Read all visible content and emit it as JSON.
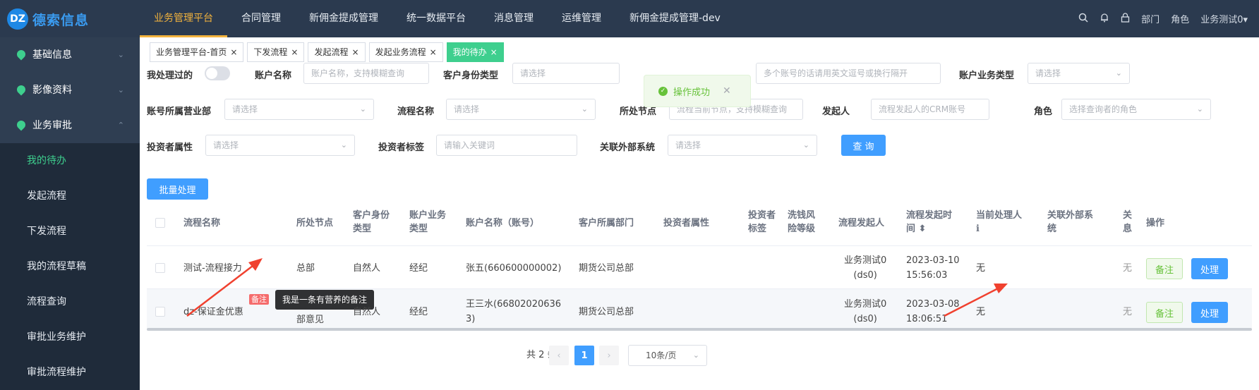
{
  "app": {
    "logo_mark": "DZ",
    "name": "德索信息"
  },
  "topnav": {
    "items": [
      "业务管理平台",
      "合同管理",
      "新佣金提成管理",
      "统一数据平台",
      "消息管理",
      "运维管理",
      "新佣金提成管理-dev"
    ],
    "right": {
      "dept": "部门",
      "role": "角色",
      "user": "业务测试0▾"
    }
  },
  "sidebar": {
    "groups": [
      {
        "label": "基础信息",
        "chevron": "⌄"
      },
      {
        "label": "影像资料",
        "chevron": "⌄"
      },
      {
        "label": "业务审批",
        "chevron": "⌃"
      }
    ],
    "subitems": [
      "我的待办",
      "发起流程",
      "下发流程",
      "我的流程草稿",
      "流程查询",
      "审批业务维护",
      "审批流程维护"
    ]
  },
  "tabs": [
    {
      "label": "业务管理平台-首页"
    },
    {
      "label": "下发流程"
    },
    {
      "label": "发起流程"
    },
    {
      "label": "发起业务流程"
    },
    {
      "label": "我的待办"
    }
  ],
  "toast": {
    "text": "操作成功"
  },
  "filters": {
    "my_processed": "我处理过的",
    "account_name": {
      "label": "账户名称",
      "placeholder": "账户名称，支持模糊查询"
    },
    "customer_type": {
      "label": "客户身份类型",
      "placeholder": "请选择"
    },
    "account_numbers": {
      "placeholder": "多个账号的话请用英文逗号或换行隔开"
    },
    "account_biz_type": {
      "label": "账户业务类型",
      "placeholder": "请选择"
    },
    "account_dept": {
      "label": "账号所属营业部",
      "placeholder": "请选择"
    },
    "process_name": {
      "label": "流程名称",
      "placeholder": "请选择"
    },
    "node": {
      "label": "所处节点",
      "placeholder": "流程当前节点，支持模糊查询"
    },
    "initiator": {
      "label": "发起人",
      "placeholder": "流程发起人的CRM账号"
    },
    "role": {
      "label": "角色",
      "placeholder": "选择查询者的角色"
    },
    "investor_attr": {
      "label": "投资者属性",
      "placeholder": "请选择"
    },
    "investor_tag": {
      "label": "投资者标签",
      "placeholder": "请输入关键词"
    },
    "external_system": {
      "label": "关联外部系统",
      "placeholder": "请选择"
    },
    "query_button": "查 询"
  },
  "batch_button": "批量处理",
  "table": {
    "headers": {
      "name": "流程名称",
      "node": "所处节点",
      "cust_type": [
        "客户身份",
        "类型"
      ],
      "biz_type": [
        "账户业务",
        "类型"
      ],
      "account": "账户名称（账号）",
      "dept": "客户所属部门",
      "investor_attr": "投资者属性",
      "investor_tag": [
        "投资者",
        "标签"
      ],
      "aml": [
        "洗钱风",
        "险等级"
      ],
      "initiator": "流程发起人",
      "time": [
        "流程发起时",
        "间 ⬍"
      ],
      "handler": [
        "当前处理人",
        "ℹ"
      ],
      "external": [
        "关联外部系",
        "统"
      ],
      "extra": [
        "关",
        "息"
      ],
      "action": "操作"
    },
    "rows": [
      {
        "name": "测试-流程接力",
        "node": "总部",
        "cust_type": "自然人",
        "biz_type": "经纪",
        "account": [
          "张五(660600000002)"
        ],
        "dept": "期货公司总部",
        "initiator": [
          "业务测试0",
          "(ds0)"
        ],
        "time": [
          "2023-03-10",
          "15:56:03"
        ],
        "handler": "无",
        "extra": "无",
        "note_btn": "备注",
        "process_btn": "处理"
      },
      {
        "name": "dz-保证金优惠",
        "node": "部意见",
        "cust_type": "自然人",
        "biz_type": "经纪",
        "account": [
          "王三水(66802020636",
          "3)"
        ],
        "dept": "期货公司总部",
        "initiator": [
          "业务测试0",
          "(ds0)"
        ],
        "time": [
          "2023-03-08",
          "18:06:51"
        ],
        "handler": "无",
        "extra": "无",
        "note_badge": "备注",
        "tooltip": "我是一条有营养的备注",
        "note_btn": "备注",
        "process_btn": "处理"
      }
    ]
  },
  "pager": {
    "total": "共 2 条",
    "prev": "‹",
    "page": "1",
    "next": "›",
    "size": "10条/页"
  },
  "colors": {
    "accent": "#3ecf8e",
    "primary": "#409eff",
    "topbar": "#2b3a4f",
    "sidebar": "#2f3e52",
    "arrow": "#f0412f"
  }
}
